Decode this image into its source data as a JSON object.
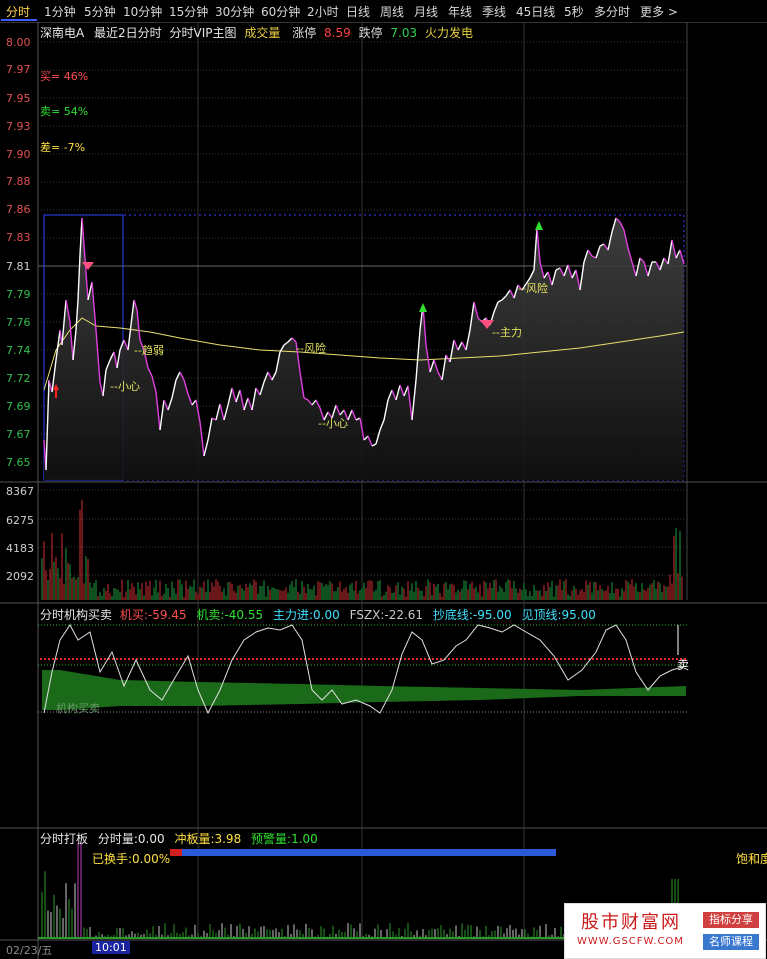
{
  "tabs": [
    "分时",
    "1分钟",
    "5分钟",
    "10分钟",
    "15分钟",
    "30分钟",
    "60分钟",
    "2小时",
    "日线",
    "周线",
    "月线",
    "年线",
    "季线",
    "45日线",
    "5秒",
    "多分时",
    "更多 >"
  ],
  "active_tab": "分时",
  "main_chart": {
    "stock_name": "深南电A",
    "period": "最近2日分时",
    "indicator_name": "分时VIP主图",
    "volume_label": "成交量",
    "limit_up_label": "涨停",
    "limit_up_value": "8.59",
    "limit_down_label": "跌停",
    "limit_down_value": "7.03",
    "concept": "火力发电",
    "sell_pct": "买= 46%",
    "sell2_pct": "卖= 54%",
    "diff_pct": "差= -7%",
    "price_ticks": [
      "8.00",
      "7.97",
      "7.95",
      "7.93",
      "7.90",
      "7.88",
      "7.86",
      "7.83",
      "7.81",
      "7.79",
      "7.76",
      "7.74",
      "7.72",
      "7.69",
      "7.67",
      "7.65"
    ],
    "annotations": {
      "a1": "--趋弱",
      "a2": "--小心",
      "a3": "--风险",
      "a4": "--小心",
      "a5": "--风险",
      "a6": "--主力"
    }
  },
  "volume_chart": {
    "ticks": [
      "8367",
      "6275",
      "4183",
      "2092"
    ]
  },
  "institution_panel": {
    "name": "分时机构买卖",
    "buy_label": "机买:",
    "buy_value": "-59.45",
    "sell_label": "机卖:",
    "sell_value": "-40.55",
    "main_in_label": "主力进:",
    "main_in_value": "0.00",
    "fszx_label": "FSZX:",
    "fszx_value": "-22.61",
    "bottom_label": "抄底线:",
    "bottom_value": "-95.00",
    "top_label": "见顶线:",
    "top_value": "95.00",
    "tag_sell": "卖",
    "tag_buy": "机构买卖"
  },
  "board_panel": {
    "name": "分时打板",
    "vol_label": "分时量:",
    "vol_value": "0.00",
    "board_label": "冲板量:",
    "board_value": "3.98",
    "warn_label": "预警量:",
    "warn_value": "1.00",
    "turnover_label": "已换手:0.00%",
    "saturation_label": "饱和度"
  },
  "footer": {
    "date": "02/23/五",
    "time": "10:01"
  },
  "watermark": {
    "site": "股市财富网",
    "url": "WWW.GSCFW.COM",
    "tag1": "指标分享",
    "tag2": "名师课程"
  },
  "colors": {
    "price_line": "#e040e0",
    "price_line_up": "#ffffff",
    "avg_line": "#e8e070",
    "up": "#e04040",
    "down": "#20c040",
    "grid": "#3a3a3a",
    "dotted_blue": "#3c3cff"
  }
}
